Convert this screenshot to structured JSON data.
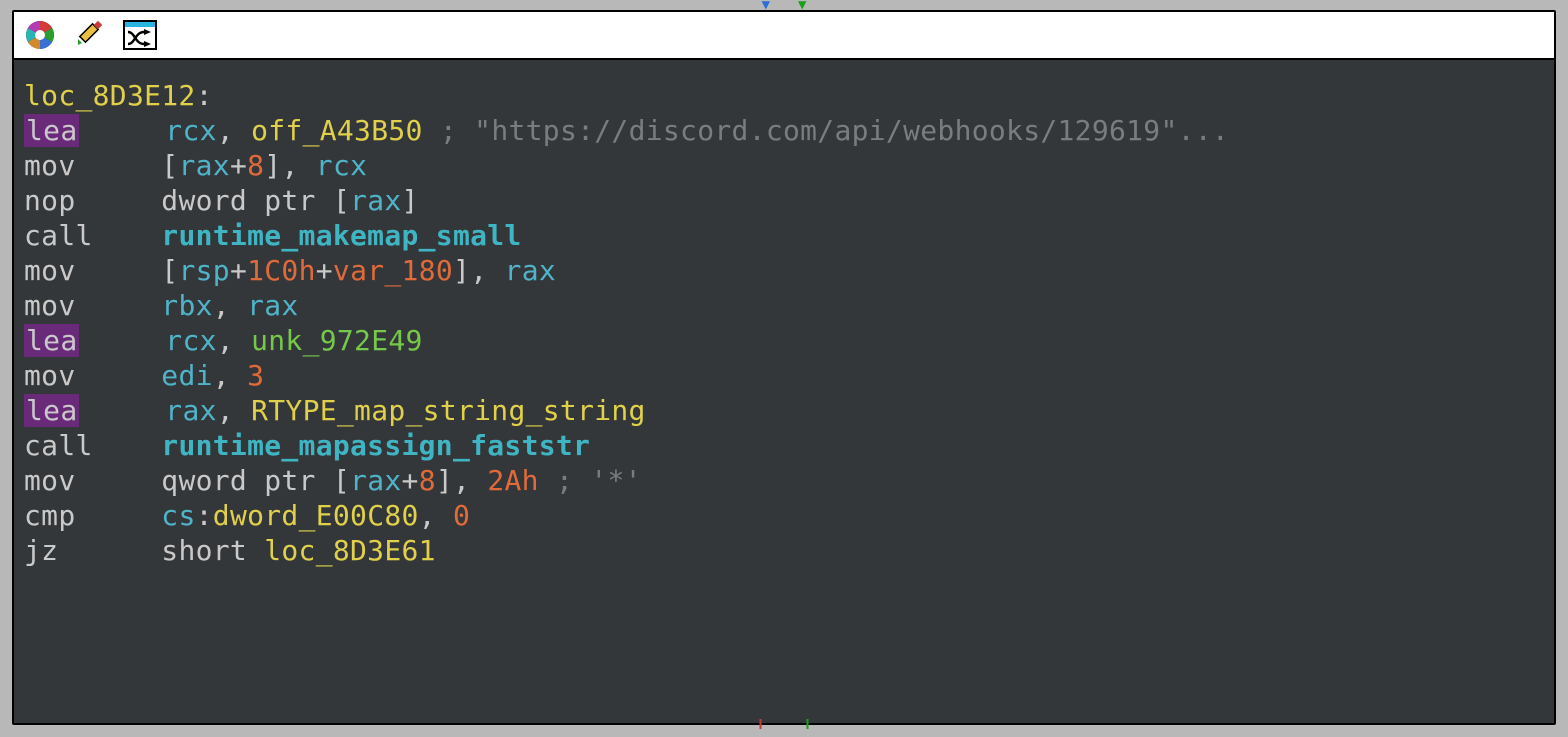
{
  "colors": {
    "panel_bg": "#34373a",
    "label": "#e0d04a",
    "register": "#4fb4c9",
    "number": "#e06a3a",
    "call": "#3fb5c4",
    "symbol_green": "#76c84a",
    "comment": "#7a7d80",
    "highlight_bg": "#6a2a7a"
  },
  "toolbar": {
    "graph_icon": "color-wheel-icon",
    "edit_icon": "edit-icon",
    "xref_icon": "shuffle-icon"
  },
  "block": {
    "label": "loc_8D3E12",
    "lines": [
      {
        "mnemonic": "lea",
        "mn_hl": true,
        "tokens": [
          {
            "t": "reg",
            "v": "rcx"
          },
          {
            "t": "plain",
            "v": ", "
          },
          {
            "t": "sym-yellow",
            "v": "off_A43B50"
          },
          {
            "t": "plain",
            "v": " "
          },
          {
            "t": "comment",
            "v": "; \"https://discord.com/api/webhooks/129619\"..."
          }
        ]
      },
      {
        "mnemonic": "mov",
        "tokens": [
          {
            "t": "br",
            "v": "["
          },
          {
            "t": "reg",
            "v": "rax"
          },
          {
            "t": "plain",
            "v": "+"
          },
          {
            "t": "num",
            "v": "8"
          },
          {
            "t": "br",
            "v": "]"
          },
          {
            "t": "plain",
            "v": ", "
          },
          {
            "t": "reg",
            "v": "rcx"
          }
        ]
      },
      {
        "mnemonic": "nop",
        "tokens": [
          {
            "t": "kw",
            "v": "dword ptr "
          },
          {
            "t": "br",
            "v": "["
          },
          {
            "t": "reg",
            "v": "rax"
          },
          {
            "t": "br",
            "v": "]"
          }
        ]
      },
      {
        "mnemonic": "call",
        "tokens": [
          {
            "t": "funccall",
            "v": "runtime_makemap_small"
          }
        ]
      },
      {
        "mnemonic": "mov",
        "tokens": [
          {
            "t": "br",
            "v": "["
          },
          {
            "t": "reg",
            "v": "rsp"
          },
          {
            "t": "plain",
            "v": "+"
          },
          {
            "t": "num",
            "v": "1C0h"
          },
          {
            "t": "plain",
            "v": "+"
          },
          {
            "t": "num",
            "v": "var_180"
          },
          {
            "t": "br",
            "v": "]"
          },
          {
            "t": "plain",
            "v": ", "
          },
          {
            "t": "reg",
            "v": "rax"
          }
        ]
      },
      {
        "mnemonic": "mov",
        "tokens": [
          {
            "t": "reg",
            "v": "rbx"
          },
          {
            "t": "plain",
            "v": ", "
          },
          {
            "t": "reg",
            "v": "rax"
          }
        ]
      },
      {
        "mnemonic": "lea",
        "mn_hl": true,
        "tokens": [
          {
            "t": "reg",
            "v": "rcx"
          },
          {
            "t": "plain",
            "v": ", "
          },
          {
            "t": "sym-green",
            "v": "unk_972E49"
          }
        ]
      },
      {
        "mnemonic": "mov",
        "tokens": [
          {
            "t": "reg",
            "v": "edi"
          },
          {
            "t": "plain",
            "v": ", "
          },
          {
            "t": "num",
            "v": "3"
          }
        ]
      },
      {
        "mnemonic": "lea",
        "mn_hl": true,
        "tokens": [
          {
            "t": "reg",
            "v": "rax"
          },
          {
            "t": "plain",
            "v": ", "
          },
          {
            "t": "sym-yellow",
            "v": "RTYPE_map_string_string"
          }
        ]
      },
      {
        "mnemonic": "call",
        "tokens": [
          {
            "t": "funccall",
            "v": "runtime_mapassign_faststr"
          }
        ]
      },
      {
        "mnemonic": "mov",
        "tokens": [
          {
            "t": "kw",
            "v": "qword ptr "
          },
          {
            "t": "br",
            "v": "["
          },
          {
            "t": "reg",
            "v": "rax"
          },
          {
            "t": "plain",
            "v": "+"
          },
          {
            "t": "num",
            "v": "8"
          },
          {
            "t": "br",
            "v": "]"
          },
          {
            "t": "plain",
            "v": ", "
          },
          {
            "t": "num",
            "v": "2Ah"
          },
          {
            "t": "plain",
            "v": " "
          },
          {
            "t": "comment",
            "v": "; '*'"
          }
        ]
      },
      {
        "mnemonic": "cmp",
        "tokens": [
          {
            "t": "seg",
            "v": "cs"
          },
          {
            "t": "plain",
            "v": ":"
          },
          {
            "t": "sym-yellow",
            "v": "dword_E00C80"
          },
          {
            "t": "plain",
            "v": ", "
          },
          {
            "t": "num",
            "v": "0"
          }
        ]
      },
      {
        "mnemonic": "jz",
        "tokens": [
          {
            "t": "kw",
            "v": "short "
          },
          {
            "t": "sym-yellow",
            "v": "loc_8D3E61"
          }
        ]
      }
    ]
  }
}
